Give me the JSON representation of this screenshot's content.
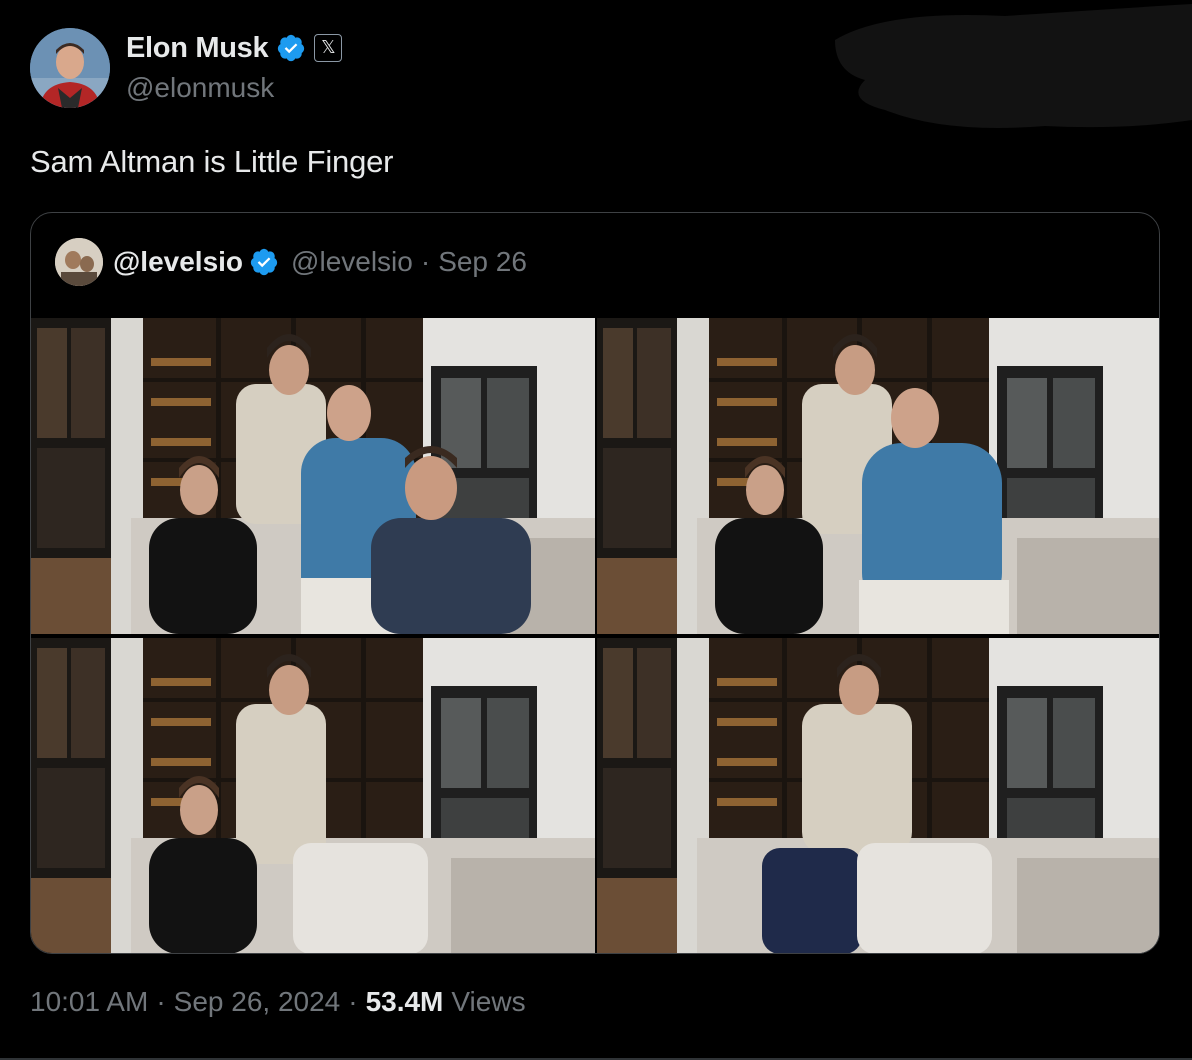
{
  "author": {
    "display_name": "Elon Musk",
    "handle": "@elonmusk",
    "x_badge_glyph": "𝕏",
    "avatar_icon": "profile-photo-icon",
    "verified_color": "#1d9bf0"
  },
  "tweet": {
    "text": "Sam Altman is Little Finger"
  },
  "quote": {
    "display_name": "@levelsio",
    "handle": "@levelsio",
    "separator": "·",
    "date": "Sep 26",
    "media": [
      {
        "name": "photo-four-people",
        "people": 4
      },
      {
        "name": "photo-three-people",
        "people": 3
      },
      {
        "name": "photo-two-people",
        "people": 2
      },
      {
        "name": "photo-one-person",
        "people": 1
      }
    ]
  },
  "footer": {
    "time": "10:01 AM",
    "separator": "·",
    "date": "Sep 26, 2024",
    "views_count": "53.4M",
    "views_label": "Views"
  },
  "colors": {
    "background": "#000000",
    "text_primary": "#e7e9ea",
    "text_secondary": "#71767b",
    "border": "#3e4144",
    "verified_blue": "#1d9bf0"
  }
}
